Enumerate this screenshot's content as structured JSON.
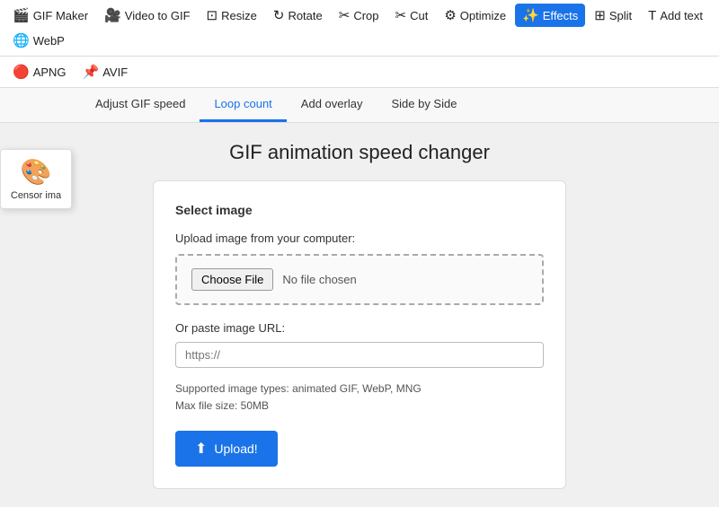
{
  "nav": {
    "items": [
      {
        "label": "GIF Maker",
        "icon": "🎬",
        "active": false
      },
      {
        "label": "Video to GIF",
        "icon": "🎥",
        "active": false
      },
      {
        "label": "Resize",
        "icon": "⊡",
        "active": false
      },
      {
        "label": "Rotate",
        "icon": "↻",
        "active": false
      },
      {
        "label": "Crop",
        "icon": "✂",
        "active": false
      },
      {
        "label": "Cut",
        "icon": "✂",
        "active": false
      },
      {
        "label": "Optimize",
        "icon": "⚙",
        "active": false
      },
      {
        "label": "Effects",
        "icon": "✨",
        "active": true
      },
      {
        "label": "Split",
        "icon": "⊞",
        "active": false
      },
      {
        "label": "Add text",
        "icon": "T",
        "active": false
      },
      {
        "label": "WebP",
        "icon": "🌐",
        "active": false
      }
    ]
  },
  "second_nav": {
    "items": [
      {
        "label": "APNG",
        "icon": "🔴"
      },
      {
        "label": "AVIF",
        "icon": "📌"
      }
    ]
  },
  "censor": {
    "label": "Censor ima"
  },
  "tabs": {
    "items": [
      {
        "label": "Adjust GIF speed",
        "active": false
      },
      {
        "label": "Loop count",
        "active": false
      },
      {
        "label": "Add overlay",
        "active": false
      },
      {
        "label": "Side by Side",
        "active": false
      }
    ]
  },
  "page": {
    "title": "GIF animation speed changer"
  },
  "card": {
    "section_title": "Select image",
    "upload_label": "Upload image from your computer:",
    "choose_file_label": "Choose File",
    "no_file_label": "No file chosen",
    "paste_label": "Or paste image URL:",
    "url_placeholder": "https://",
    "supported_text": "Supported image types: animated GIF, WebP, MNG\nMax file size: 50MB",
    "upload_btn_label": "Upload!"
  }
}
